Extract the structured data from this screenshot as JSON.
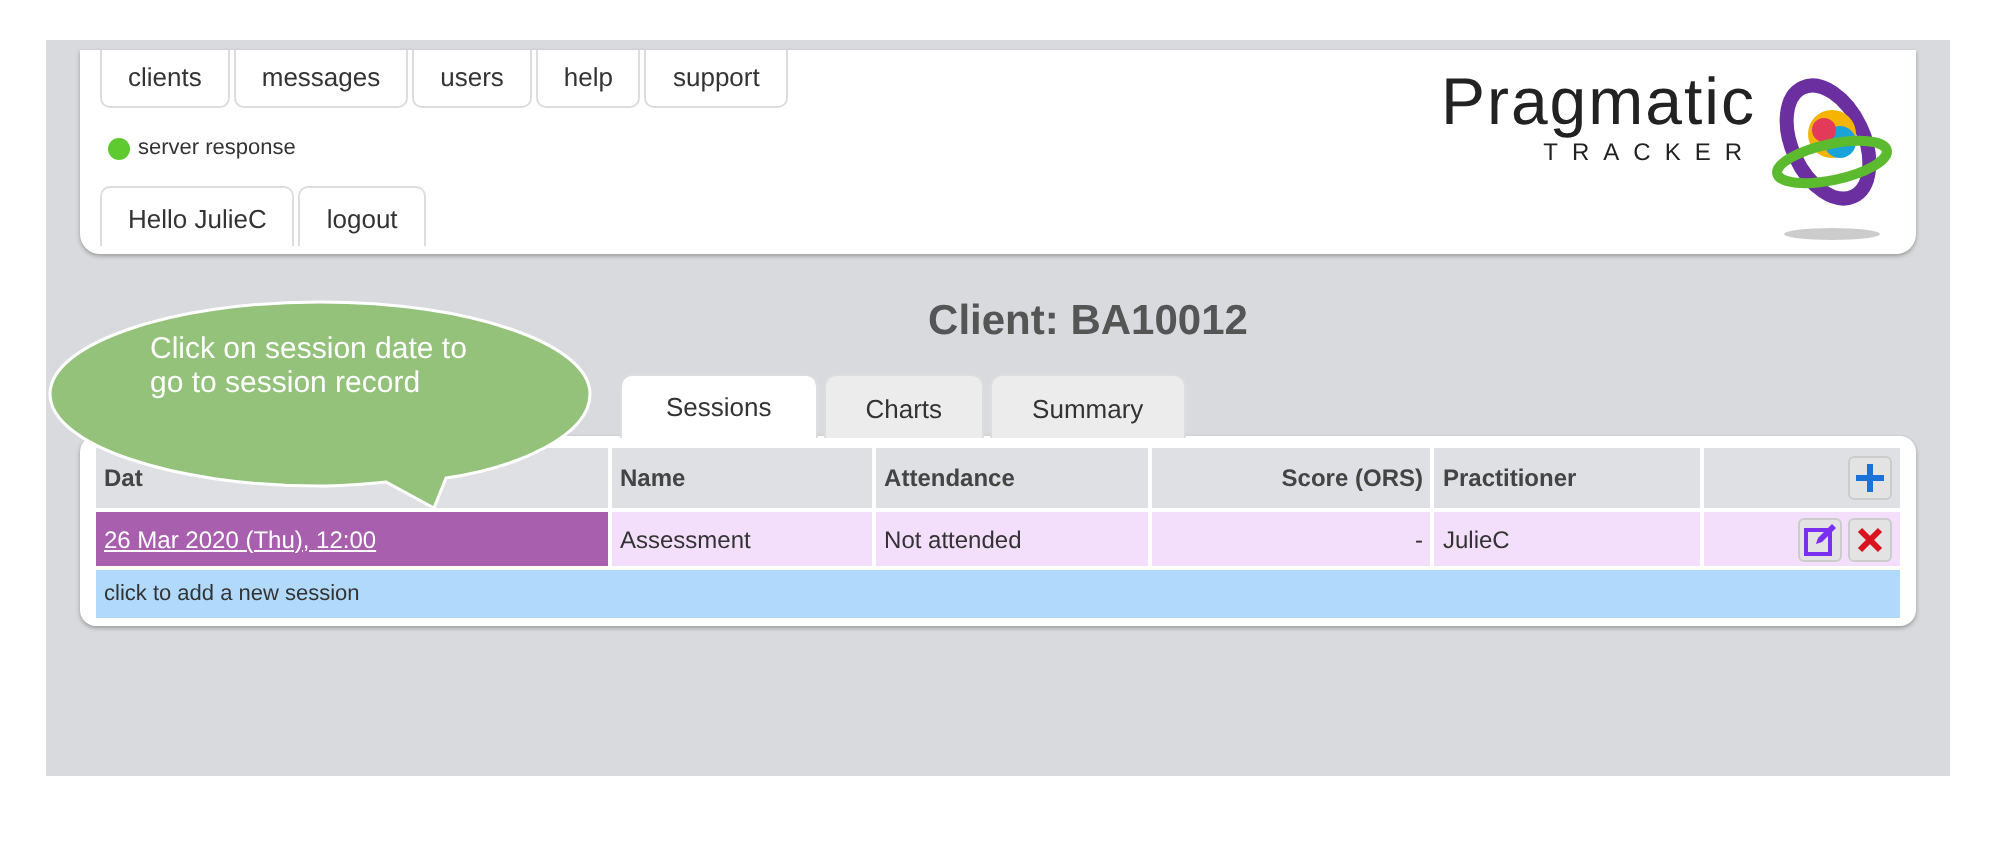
{
  "nav": {
    "menu": [
      "clients",
      "messages",
      "users",
      "help",
      "support"
    ],
    "status": {
      "label": "server response",
      "color": "#5fc930"
    },
    "user": [
      "Hello JulieC",
      "logout"
    ]
  },
  "logo": {
    "name": "Pragmatic",
    "tagline": "TRACKER"
  },
  "title": "Client: BA10012",
  "tabs": [
    {
      "label": "Sessions",
      "selected": true
    },
    {
      "label": "Charts",
      "selected": false
    },
    {
      "label": "Summary",
      "selected": false
    }
  ],
  "table": {
    "columns": [
      "Dat",
      "Name",
      "Attendance",
      "Score (ORS)",
      "Practitioner"
    ],
    "rows": [
      {
        "cells": [
          "26 Mar 2020 (Thu), 12:00",
          "Assessment",
          "Not attended",
          "-",
          "JulieC"
        ]
      }
    ],
    "add_row": "click to add a new session"
  },
  "callout": "Click on session date to go to session record"
}
